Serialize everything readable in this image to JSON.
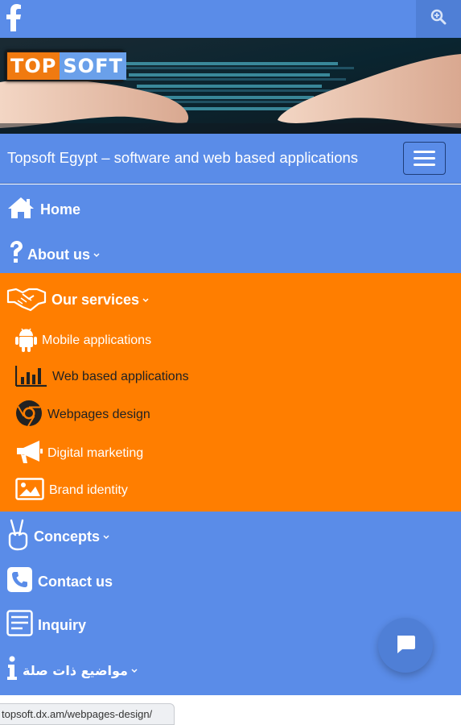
{
  "header": {
    "facebook_icon": "facebook-icon",
    "search_icon": "zoom-search-icon",
    "bar_color": "#5a8ce8"
  },
  "banner": {
    "logo_left": "TOP",
    "logo_right": "SOFT"
  },
  "site": {
    "title": "Topsoft Egypt – software and web based applications",
    "menu_toggle_icon": "hamburger-icon"
  },
  "nav": {
    "items": [
      {
        "label": "Home",
        "icon": "home-icon",
        "has_caret": false
      },
      {
        "label": "About us",
        "icon": "question-icon",
        "has_caret": true
      },
      {
        "label": "Our services",
        "icon": "handshake-icon",
        "has_caret": true,
        "active": true
      },
      {
        "label": "Concepts",
        "icon": "victory-hand-icon",
        "has_caret": true
      },
      {
        "label": "Contact us",
        "icon": "phone-icon",
        "has_caret": false
      },
      {
        "label": "Inquiry",
        "icon": "form-icon",
        "has_caret": false
      },
      {
        "label": "مواضيع ذات صلة",
        "icon": "info-icon",
        "has_caret": true
      }
    ],
    "services_submenu": [
      {
        "label": "Mobile applications",
        "icon": "android-icon"
      },
      {
        "label": "Web based applications",
        "icon": "bar-chart-icon"
      },
      {
        "label": "Webpages design",
        "icon": "chrome-icon"
      },
      {
        "label": "Digital marketing",
        "icon": "megaphone-icon"
      },
      {
        "label": "Brand identity",
        "icon": "image-icon"
      }
    ]
  },
  "colors": {
    "blue": "#5a8ce8",
    "orange": "#ff7e00",
    "white_text": "#ffffff",
    "dark_text": "#222222"
  },
  "status": {
    "url": "topsoft.dx.am/webpages-design/"
  },
  "chat": {
    "icon": "chat-bubble-icon"
  }
}
